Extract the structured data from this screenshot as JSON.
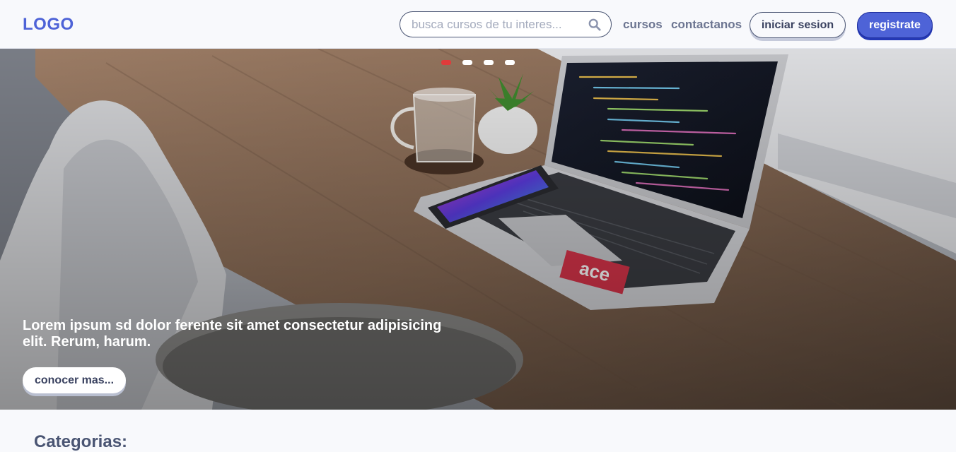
{
  "header": {
    "logo": "LOGO",
    "search": {
      "placeholder": "busca cursos de tu interes...",
      "value": "",
      "icon": "search-icon"
    },
    "nav": [
      {
        "label": "cursos"
      },
      {
        "label": "contactanos"
      }
    ],
    "login_label": "iniciar sesion",
    "register_label": "registrate"
  },
  "hero": {
    "carousel": {
      "slides": 4,
      "active_index": 0
    },
    "text": "Lorem ipsum sd dolor ferente sit amet consectetur adipisicing elit. Rerum, harum.",
    "cta_label": "conocer mas...",
    "laptop_sticker": "ace"
  },
  "main": {
    "categories_title": "Categorias:"
  },
  "colors": {
    "accent": "#4e63d7",
    "text_dark": "#3a4260",
    "text_muted": "#6c7591",
    "active_dot": "#e03b3b"
  }
}
